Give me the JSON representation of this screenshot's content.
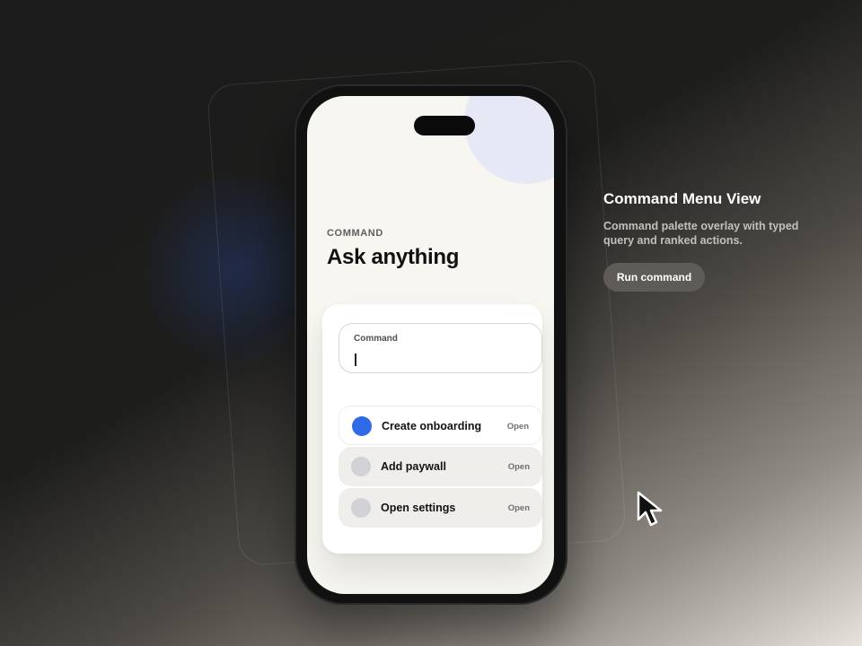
{
  "screen": {
    "eyebrow": "COMMAND",
    "headline": "Ask anything"
  },
  "palette": {
    "input_label": "Command",
    "input_value": "",
    "actions": [
      {
        "label": "Create onboarding",
        "meta": "Open",
        "state": "active",
        "color": "#2f6be6"
      },
      {
        "label": "Add paywall",
        "meta": "Open",
        "state": "idle",
        "color": "#d2d2d6"
      },
      {
        "label": "Open settings",
        "meta": "Open",
        "state": "idle",
        "color": "#d2d2d6"
      }
    ]
  },
  "info": {
    "title": "Command Menu View",
    "description": "Command palette overlay with typed query and ranked actions.",
    "button_label": "Run command"
  },
  "icons": {
    "cursor": "cursor-arrow-icon"
  }
}
